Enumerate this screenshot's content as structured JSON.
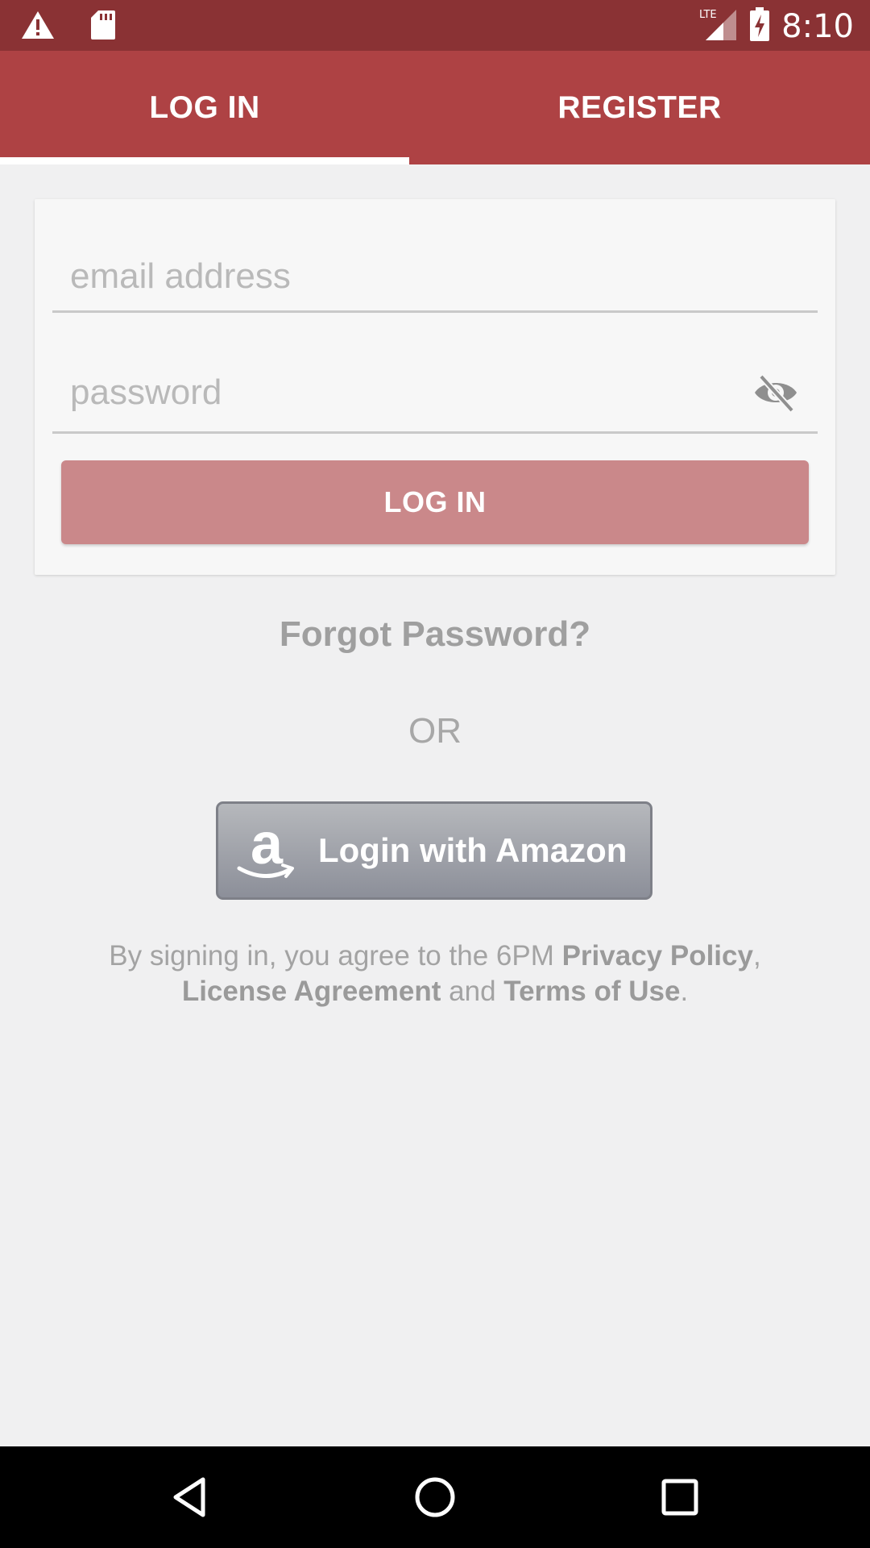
{
  "status_bar": {
    "time": "8:10",
    "network": "LTE",
    "left_icons": [
      "warning-icon",
      "sd-card-icon"
    ],
    "right_icons": [
      "signal-icon",
      "battery-charging-icon"
    ]
  },
  "tabs": [
    {
      "label": "LOG IN",
      "active": true
    },
    {
      "label": "REGISTER",
      "active": false
    }
  ],
  "form": {
    "email_placeholder": "email address",
    "email_value": "",
    "password_placeholder": "password",
    "password_value": "",
    "toggle_icon": "eye-off-icon",
    "submit_label": "LOG IN"
  },
  "forgot_password": "Forgot Password?",
  "divider_or": "OR",
  "amazon_button": {
    "logo_letter": "a",
    "label": "Login with Amazon"
  },
  "legal": {
    "prefix": "By signing in, you agree to the 6PM ",
    "privacy_policy": "Privacy Policy",
    "comma": ",",
    "license_agreement": "License Agreement",
    "and": " and ",
    "terms": "Terms of Use",
    "period": "."
  },
  "nav_bar": {
    "buttons": [
      "back-icon",
      "home-icon",
      "recents-icon"
    ]
  },
  "colors": {
    "status_bar": "#8a3234",
    "app_bar": "#ae4244",
    "login_button": "#ca888a",
    "background": "#f0f0f1"
  }
}
